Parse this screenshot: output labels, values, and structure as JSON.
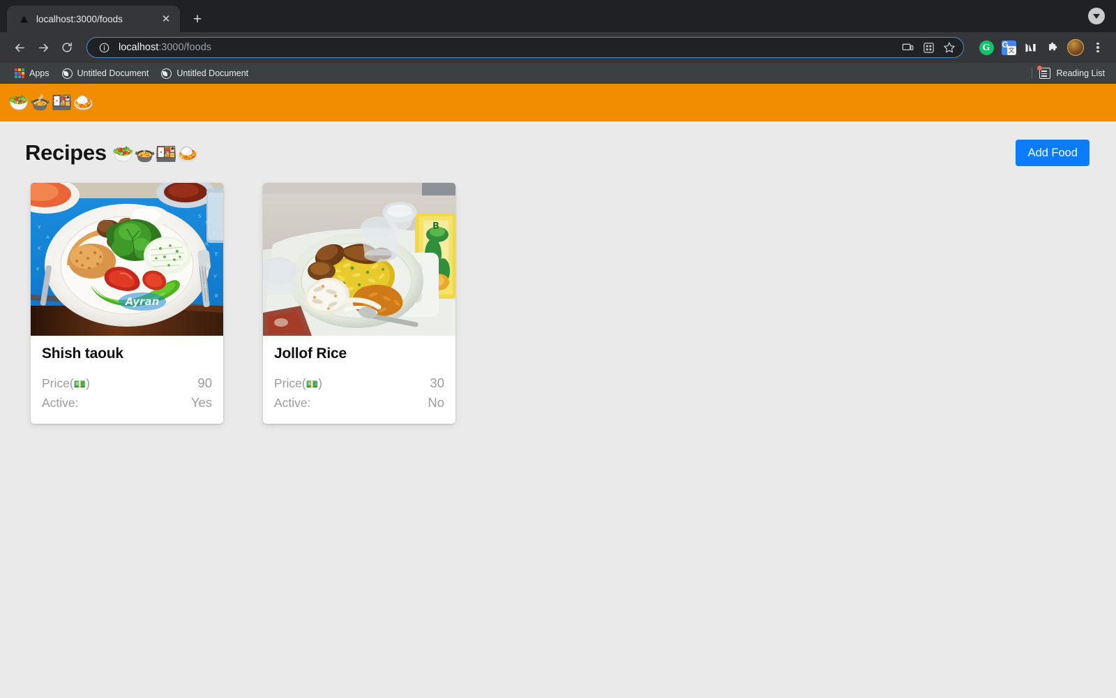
{
  "browser": {
    "tab": {
      "title": "localhost:3000/foods",
      "favicon_name": "triangle-favicon",
      "close_label": "✕"
    },
    "new_tab_label": "+",
    "tab_search_name": "tab-search-dropdown",
    "nav": {
      "back_label": "←",
      "forward_label": "→",
      "reload_label": "⟳"
    },
    "omnibox": {
      "url_host": "localhost",
      "url_rest": ":3000/foods",
      "info_icon": "info-circle-icon",
      "icons": [
        "cast-icon",
        "qr-code-icon",
        "bookmark-star-icon"
      ]
    },
    "extensions": [
      {
        "name": "grammarly-extension",
        "label": "G"
      },
      {
        "name": "google-translate-extension",
        "label": "G",
        "sub": "文"
      },
      {
        "name": "medium-extension",
        "label": "M"
      },
      {
        "name": "extensions-puzzle-icon",
        "label": "🧩"
      }
    ],
    "profile_name": "profile-avatar",
    "menu_name": "chrome-menu-button",
    "bookmarks": [
      {
        "label": "Apps",
        "icon": "apps-grid-icon"
      },
      {
        "label": "Untitled Document",
        "icon": "globe-icon"
      },
      {
        "label": "Untitled Document",
        "icon": "globe-icon"
      }
    ],
    "reading_list": {
      "label": "Reading List",
      "icon": "reading-list-icon",
      "has_badge": true
    }
  },
  "site": {
    "navbar": {
      "brand_emoji": "🥗🍲🍱🍛",
      "background": "#f28c00"
    },
    "heading": {
      "text": "Recipes ",
      "emoji": "🥗🍲🍱🍛"
    },
    "add_button": {
      "label": "Add Food",
      "color": "#0d7cfc"
    },
    "labels": {
      "price": "Price(",
      "price_emoji": "💵",
      "price_close": ")",
      "active": "Active:"
    },
    "foods": [
      {
        "name": "Shish taouk",
        "price": "90",
        "active": "Yes",
        "image_alt": "shish-taouk-plate"
      },
      {
        "name": "Jollof Rice",
        "price": "30",
        "active": "No",
        "image_alt": "jollof-rice-plate"
      }
    ]
  }
}
